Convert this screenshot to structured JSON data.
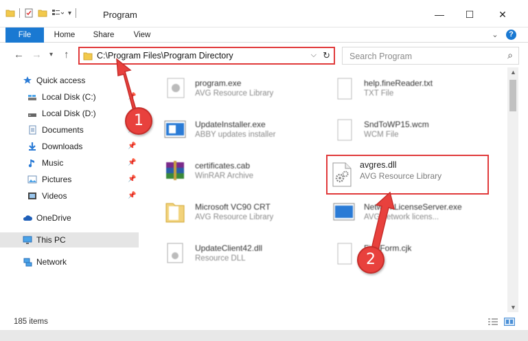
{
  "window": {
    "title": "Program",
    "minimize": "—",
    "maximize": "☐",
    "close": "✕"
  },
  "ribbon": {
    "tabs": [
      "File",
      "Home",
      "Share",
      "View"
    ],
    "expand": "⌄",
    "help": "?"
  },
  "address": {
    "path": "C:\\Program Files\\Program Directory",
    "search_placeholder": "Search Program"
  },
  "sidebar": {
    "items": [
      {
        "label": "Quick access",
        "icon": "star-icon",
        "pinned": false
      },
      {
        "label": "Local Disk (C:)",
        "icon": "drive-icon",
        "pinned": true
      },
      {
        "label": "Local Disk (D:)",
        "icon": "drive-icon",
        "pinned": true
      },
      {
        "label": "Documents",
        "icon": "documents-icon",
        "pinned": true
      },
      {
        "label": "Downloads",
        "icon": "download-icon",
        "pinned": true
      },
      {
        "label": "Music",
        "icon": "music-icon",
        "pinned": true
      },
      {
        "label": "Pictures",
        "icon": "pictures-icon",
        "pinned": true
      },
      {
        "label": "Videos",
        "icon": "videos-icon",
        "pinned": true
      },
      {
        "label": "OneDrive",
        "icon": "cloud-icon",
        "pinned": false
      },
      {
        "label": "This PC",
        "icon": "computer-icon",
        "pinned": false
      },
      {
        "label": "Network",
        "icon": "network-icon",
        "pinned": false
      }
    ]
  },
  "files": {
    "left": [
      {
        "name": "program.exe",
        "type": "AVG Resource Library"
      },
      {
        "name": "UpdateInstaller.exe",
        "type": "ABBY updates installer"
      },
      {
        "name": "certificates.cab",
        "type": "WinRAR Archive"
      },
      {
        "name": "Microsoft VC90 CRT",
        "type": "AVG Resource Library"
      },
      {
        "name": "UpdateClient42.dll",
        "type": "Resource DLL"
      }
    ],
    "right": [
      {
        "name": "help.fineReader.txt",
        "type": "TXT File"
      },
      {
        "name": "SndToWP15.wcm",
        "type": "WCM File"
      },
      {
        "name": "avgres.dll",
        "type": "AVG Resource Library"
      },
      {
        "name": "NetworkLicenseServer.exe",
        "type": "AVG network licens..."
      },
      {
        "name": "FineForm.cjk",
        "type": ""
      }
    ]
  },
  "status": {
    "item_count": "185 items"
  },
  "callouts": [
    "1",
    "2"
  ],
  "colors": {
    "accent": "#1a79d2",
    "highlight": "#e0393a",
    "selected_bg": "#e5e5e5"
  }
}
